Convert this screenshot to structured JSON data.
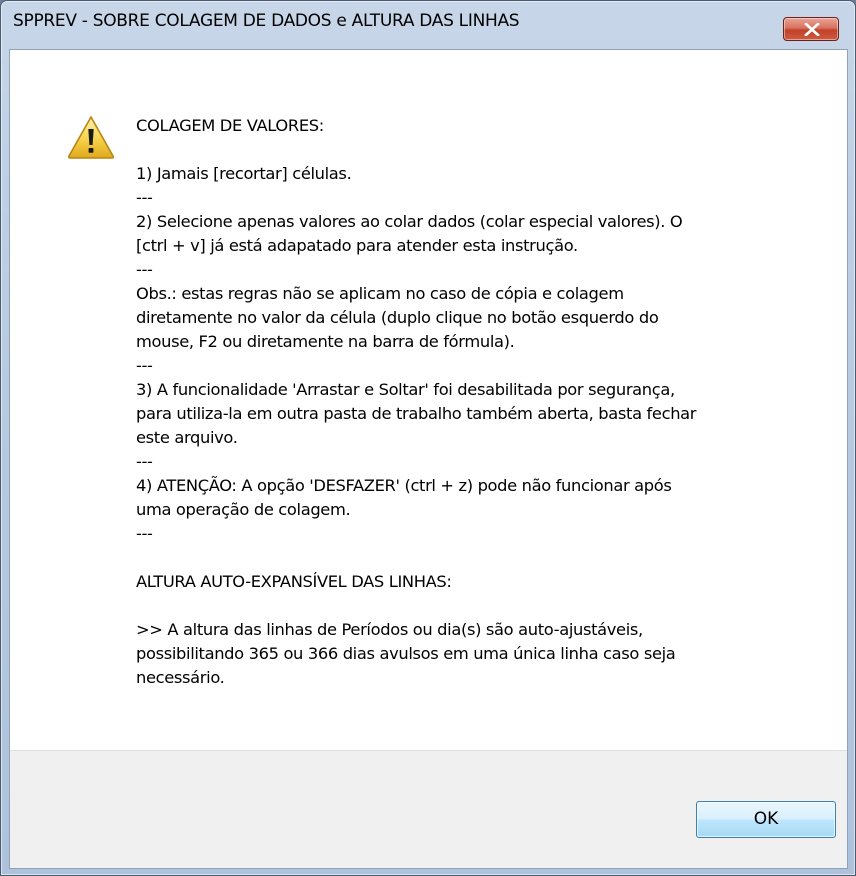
{
  "window": {
    "title": "SPPREV - SOBRE COLAGEM DE DADOS e ALTURA DAS LINHAS",
    "close_icon": "close-x-icon"
  },
  "dialog": {
    "icon": "warning-icon",
    "section1_title": "COLAGEM DE VALORES:",
    "lines": [
      "1) Jamais [recortar] células.",
      "---",
      "2) Selecione apenas valores ao colar dados (colar especial valores). O",
      "[ctrl + v] já está adapatado para atender esta instrução.",
      "---",
      "Obs.: estas regras não se aplicam no caso de cópia e colagem",
      "diretamente no valor da célula (duplo clique no botão esquerdo do",
      "mouse, F2 ou diretamente na barra de fórmula).",
      "---",
      "3) A funcionalidade 'Arrastar e Soltar' foi desabilitada por segurança,",
      "para utiliza-la em outra pasta de trabalho também aberta, basta fechar",
      "este arquivo.",
      "---",
      "4) ATENÇÃO: A opção 'DESFAZER' (ctrl + z) pode não funcionar após",
      "uma operação de colagem.",
      "---"
    ],
    "section2_title": "ALTURA AUTO-EXPANSÍVEL DAS LINHAS:",
    "section2_lines": [
      ">> A altura das linhas de Períodos ou dia(s) são auto-ajustáveis,",
      "possibilitando 365 ou 366 dias avulsos em uma única linha caso seja",
      "necessário."
    ]
  },
  "buttons": {
    "ok_label": "OK"
  },
  "colors": {
    "titlebar": "#b9cbe1",
    "close_button": "#c1412a",
    "client_bg": "#ffffff",
    "footer_bg": "#f0f0f0",
    "ok_border": "#3c7fb1"
  }
}
